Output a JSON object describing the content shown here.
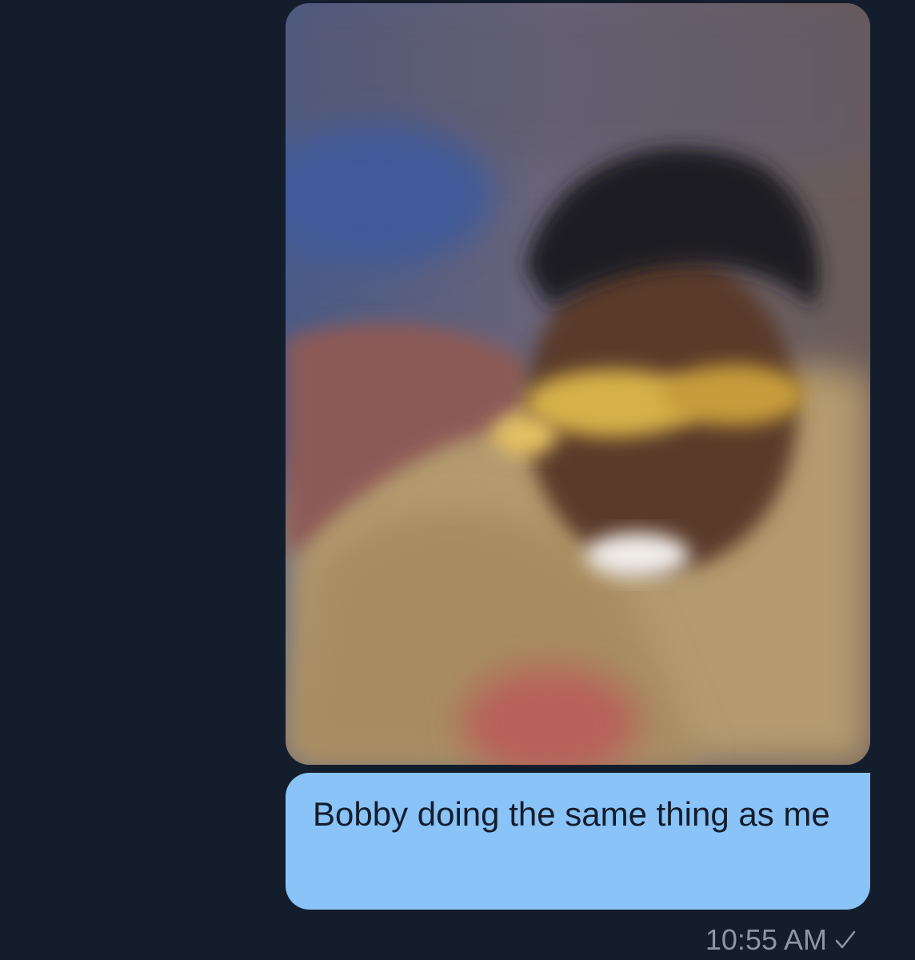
{
  "conversation": {
    "messages": [
      {
        "type": "photo",
        "direction": "outgoing"
      },
      {
        "type": "text",
        "direction": "outgoing",
        "text": "Bobby doing the same thing as me"
      }
    ],
    "timestamp": "10:55 AM",
    "receipt_icon": "checkmark-icon"
  },
  "colors": {
    "background": "#141d2b",
    "outgoing_bubble": "#89c3f8",
    "bubble_text": "#141d2b",
    "timestamp_text": "#8b97a4"
  }
}
